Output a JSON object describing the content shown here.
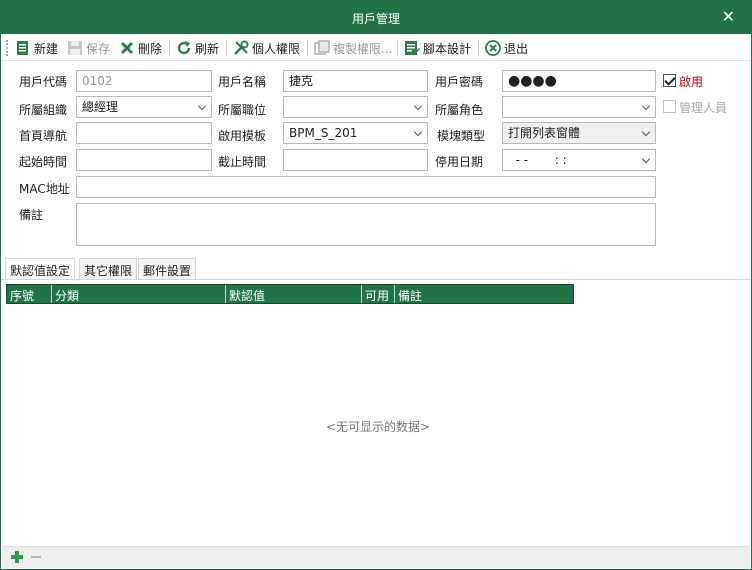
{
  "window": {
    "title": "用戶管理",
    "close_glyph": "✕"
  },
  "toolbar": {
    "buttons": [
      {
        "label": "新建",
        "icon": "new-doc-icon"
      },
      {
        "label": "保存",
        "icon": "save-icon",
        "disabled": true
      },
      {
        "label": "刪除",
        "icon": "delete-x-icon"
      },
      {
        "label": "刷新",
        "icon": "refresh-icon"
      },
      {
        "label": "個人權限",
        "icon": "tools-icon"
      },
      {
        "label": "複製權限...",
        "icon": "copy-permissions-icon",
        "disabled": true
      },
      {
        "label": "腳本設計",
        "icon": "script-doc-icon"
      },
      {
        "label": "退出",
        "icon": "exit-circle-x-icon"
      }
    ]
  },
  "form": {
    "user_code": {
      "label": "用戶代碼",
      "value": "0102"
    },
    "user_name": {
      "label": "用戶名稱",
      "value": "捷克"
    },
    "password": {
      "label": "用戶密碼",
      "value": "●●●●"
    },
    "enabled": {
      "label": "啟用",
      "checked": true,
      "color": "#cc0000"
    },
    "org": {
      "label": "所屬組織",
      "value": "總經理"
    },
    "position": {
      "label": "所屬職位",
      "value": ""
    },
    "role": {
      "label": "所屬角色",
      "value": ""
    },
    "admin": {
      "label": "管理人員",
      "checked": false
    },
    "home_nav": {
      "label": "首頁導航",
      "value": ""
    },
    "template": {
      "label": "啟用模板",
      "value": "BPM_S_201"
    },
    "module_type": {
      "label": "模塊類型",
      "value": "打開列表窗體"
    },
    "start_time": {
      "label": "起始時間",
      "value": ""
    },
    "end_time": {
      "label": "截止時間",
      "value": ""
    },
    "disable_date": {
      "label": "停用日期",
      "value": "  - -       : :"
    },
    "mac": {
      "label": "MAC地址",
      "value": ""
    },
    "remark": {
      "label": "備註",
      "value": ""
    }
  },
  "tabs": [
    {
      "label": "默認值設定",
      "active": true
    },
    {
      "label": "其它權限",
      "active": false
    },
    {
      "label": "郵件設置",
      "active": false
    }
  ],
  "grid": {
    "columns": [
      "序號",
      "分類",
      "默認值",
      "可用",
      "備註"
    ],
    "empty_text": "<无可显示的数据>"
  },
  "footer": {
    "add_icon": "add-row-icon",
    "remove_icon": "remove-row-icon"
  },
  "colors": {
    "accent": "#217346",
    "enabled_label": "#cc0000"
  }
}
